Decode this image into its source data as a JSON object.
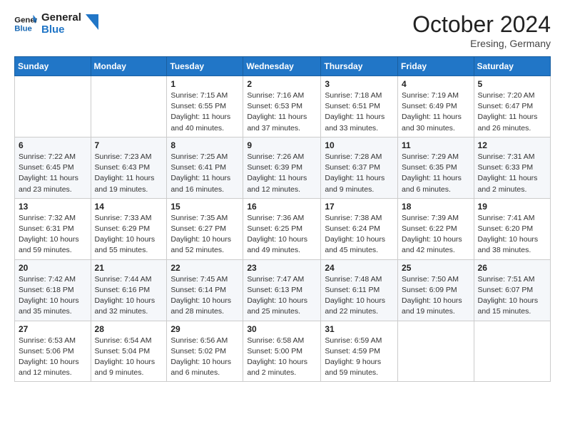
{
  "header": {
    "logo_line1": "General",
    "logo_line2": "Blue",
    "month": "October 2024",
    "location": "Eresing, Germany"
  },
  "weekdays": [
    "Sunday",
    "Monday",
    "Tuesday",
    "Wednesday",
    "Thursday",
    "Friday",
    "Saturday"
  ],
  "weeks": [
    [
      {
        "day": "",
        "sunrise": "",
        "sunset": "",
        "daylight": ""
      },
      {
        "day": "",
        "sunrise": "",
        "sunset": "",
        "daylight": ""
      },
      {
        "day": "1",
        "sunrise": "Sunrise: 7:15 AM",
        "sunset": "Sunset: 6:55 PM",
        "daylight": "Daylight: 11 hours and 40 minutes."
      },
      {
        "day": "2",
        "sunrise": "Sunrise: 7:16 AM",
        "sunset": "Sunset: 6:53 PM",
        "daylight": "Daylight: 11 hours and 37 minutes."
      },
      {
        "day": "3",
        "sunrise": "Sunrise: 7:18 AM",
        "sunset": "Sunset: 6:51 PM",
        "daylight": "Daylight: 11 hours and 33 minutes."
      },
      {
        "day": "4",
        "sunrise": "Sunrise: 7:19 AM",
        "sunset": "Sunset: 6:49 PM",
        "daylight": "Daylight: 11 hours and 30 minutes."
      },
      {
        "day": "5",
        "sunrise": "Sunrise: 7:20 AM",
        "sunset": "Sunset: 6:47 PM",
        "daylight": "Daylight: 11 hours and 26 minutes."
      }
    ],
    [
      {
        "day": "6",
        "sunrise": "Sunrise: 7:22 AM",
        "sunset": "Sunset: 6:45 PM",
        "daylight": "Daylight: 11 hours and 23 minutes."
      },
      {
        "day": "7",
        "sunrise": "Sunrise: 7:23 AM",
        "sunset": "Sunset: 6:43 PM",
        "daylight": "Daylight: 11 hours and 19 minutes."
      },
      {
        "day": "8",
        "sunrise": "Sunrise: 7:25 AM",
        "sunset": "Sunset: 6:41 PM",
        "daylight": "Daylight: 11 hours and 16 minutes."
      },
      {
        "day": "9",
        "sunrise": "Sunrise: 7:26 AM",
        "sunset": "Sunset: 6:39 PM",
        "daylight": "Daylight: 11 hours and 12 minutes."
      },
      {
        "day": "10",
        "sunrise": "Sunrise: 7:28 AM",
        "sunset": "Sunset: 6:37 PM",
        "daylight": "Daylight: 11 hours and 9 minutes."
      },
      {
        "day": "11",
        "sunrise": "Sunrise: 7:29 AM",
        "sunset": "Sunset: 6:35 PM",
        "daylight": "Daylight: 11 hours and 6 minutes."
      },
      {
        "day": "12",
        "sunrise": "Sunrise: 7:31 AM",
        "sunset": "Sunset: 6:33 PM",
        "daylight": "Daylight: 11 hours and 2 minutes."
      }
    ],
    [
      {
        "day": "13",
        "sunrise": "Sunrise: 7:32 AM",
        "sunset": "Sunset: 6:31 PM",
        "daylight": "Daylight: 10 hours and 59 minutes."
      },
      {
        "day": "14",
        "sunrise": "Sunrise: 7:33 AM",
        "sunset": "Sunset: 6:29 PM",
        "daylight": "Daylight: 10 hours and 55 minutes."
      },
      {
        "day": "15",
        "sunrise": "Sunrise: 7:35 AM",
        "sunset": "Sunset: 6:27 PM",
        "daylight": "Daylight: 10 hours and 52 minutes."
      },
      {
        "day": "16",
        "sunrise": "Sunrise: 7:36 AM",
        "sunset": "Sunset: 6:25 PM",
        "daylight": "Daylight: 10 hours and 49 minutes."
      },
      {
        "day": "17",
        "sunrise": "Sunrise: 7:38 AM",
        "sunset": "Sunset: 6:24 PM",
        "daylight": "Daylight: 10 hours and 45 minutes."
      },
      {
        "day": "18",
        "sunrise": "Sunrise: 7:39 AM",
        "sunset": "Sunset: 6:22 PM",
        "daylight": "Daylight: 10 hours and 42 minutes."
      },
      {
        "day": "19",
        "sunrise": "Sunrise: 7:41 AM",
        "sunset": "Sunset: 6:20 PM",
        "daylight": "Daylight: 10 hours and 38 minutes."
      }
    ],
    [
      {
        "day": "20",
        "sunrise": "Sunrise: 7:42 AM",
        "sunset": "Sunset: 6:18 PM",
        "daylight": "Daylight: 10 hours and 35 minutes."
      },
      {
        "day": "21",
        "sunrise": "Sunrise: 7:44 AM",
        "sunset": "Sunset: 6:16 PM",
        "daylight": "Daylight: 10 hours and 32 minutes."
      },
      {
        "day": "22",
        "sunrise": "Sunrise: 7:45 AM",
        "sunset": "Sunset: 6:14 PM",
        "daylight": "Daylight: 10 hours and 28 minutes."
      },
      {
        "day": "23",
        "sunrise": "Sunrise: 7:47 AM",
        "sunset": "Sunset: 6:13 PM",
        "daylight": "Daylight: 10 hours and 25 minutes."
      },
      {
        "day": "24",
        "sunrise": "Sunrise: 7:48 AM",
        "sunset": "Sunset: 6:11 PM",
        "daylight": "Daylight: 10 hours and 22 minutes."
      },
      {
        "day": "25",
        "sunrise": "Sunrise: 7:50 AM",
        "sunset": "Sunset: 6:09 PM",
        "daylight": "Daylight: 10 hours and 19 minutes."
      },
      {
        "day": "26",
        "sunrise": "Sunrise: 7:51 AM",
        "sunset": "Sunset: 6:07 PM",
        "daylight": "Daylight: 10 hours and 15 minutes."
      }
    ],
    [
      {
        "day": "27",
        "sunrise": "Sunrise: 6:53 AM",
        "sunset": "Sunset: 5:06 PM",
        "daylight": "Daylight: 10 hours and 12 minutes."
      },
      {
        "day": "28",
        "sunrise": "Sunrise: 6:54 AM",
        "sunset": "Sunset: 5:04 PM",
        "daylight": "Daylight: 10 hours and 9 minutes."
      },
      {
        "day": "29",
        "sunrise": "Sunrise: 6:56 AM",
        "sunset": "Sunset: 5:02 PM",
        "daylight": "Daylight: 10 hours and 6 minutes."
      },
      {
        "day": "30",
        "sunrise": "Sunrise: 6:58 AM",
        "sunset": "Sunset: 5:00 PM",
        "daylight": "Daylight: 10 hours and 2 minutes."
      },
      {
        "day": "31",
        "sunrise": "Sunrise: 6:59 AM",
        "sunset": "Sunset: 4:59 PM",
        "daylight": "Daylight: 9 hours and 59 minutes."
      },
      {
        "day": "",
        "sunrise": "",
        "sunset": "",
        "daylight": ""
      },
      {
        "day": "",
        "sunrise": "",
        "sunset": "",
        "daylight": ""
      }
    ]
  ]
}
